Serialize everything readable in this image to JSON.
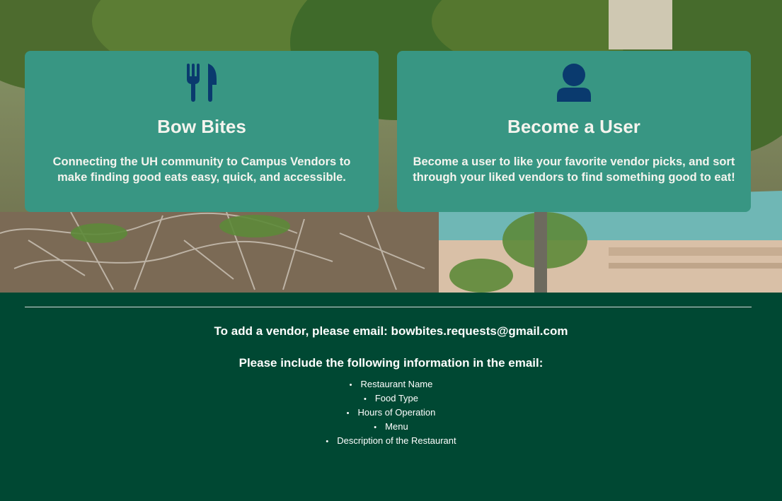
{
  "cards": [
    {
      "icon": "utensils-icon",
      "title": "Bow Bites",
      "text": "Connecting the UH community to Campus Vendors to make finding good eats easy, quick, and accessible."
    },
    {
      "icon": "user-icon",
      "title": "Become a User",
      "text": "Become a user to like your favorite vendor picks, and sort through your liked vendors to find something good to eat!"
    }
  ],
  "footer": {
    "add_vendor_text": "To add a vendor, please email: bowbites.requests@gmail.com",
    "include_text": "Please include the following information in the email:",
    "items": [
      "Restaurant Name",
      "Food Type",
      "Hours of Operation",
      "Menu",
      "Description of the Restaurant"
    ]
  },
  "colors": {
    "card_bg": "#389683",
    "icon": "#0a3a6e",
    "footer_bg": "#004833"
  }
}
